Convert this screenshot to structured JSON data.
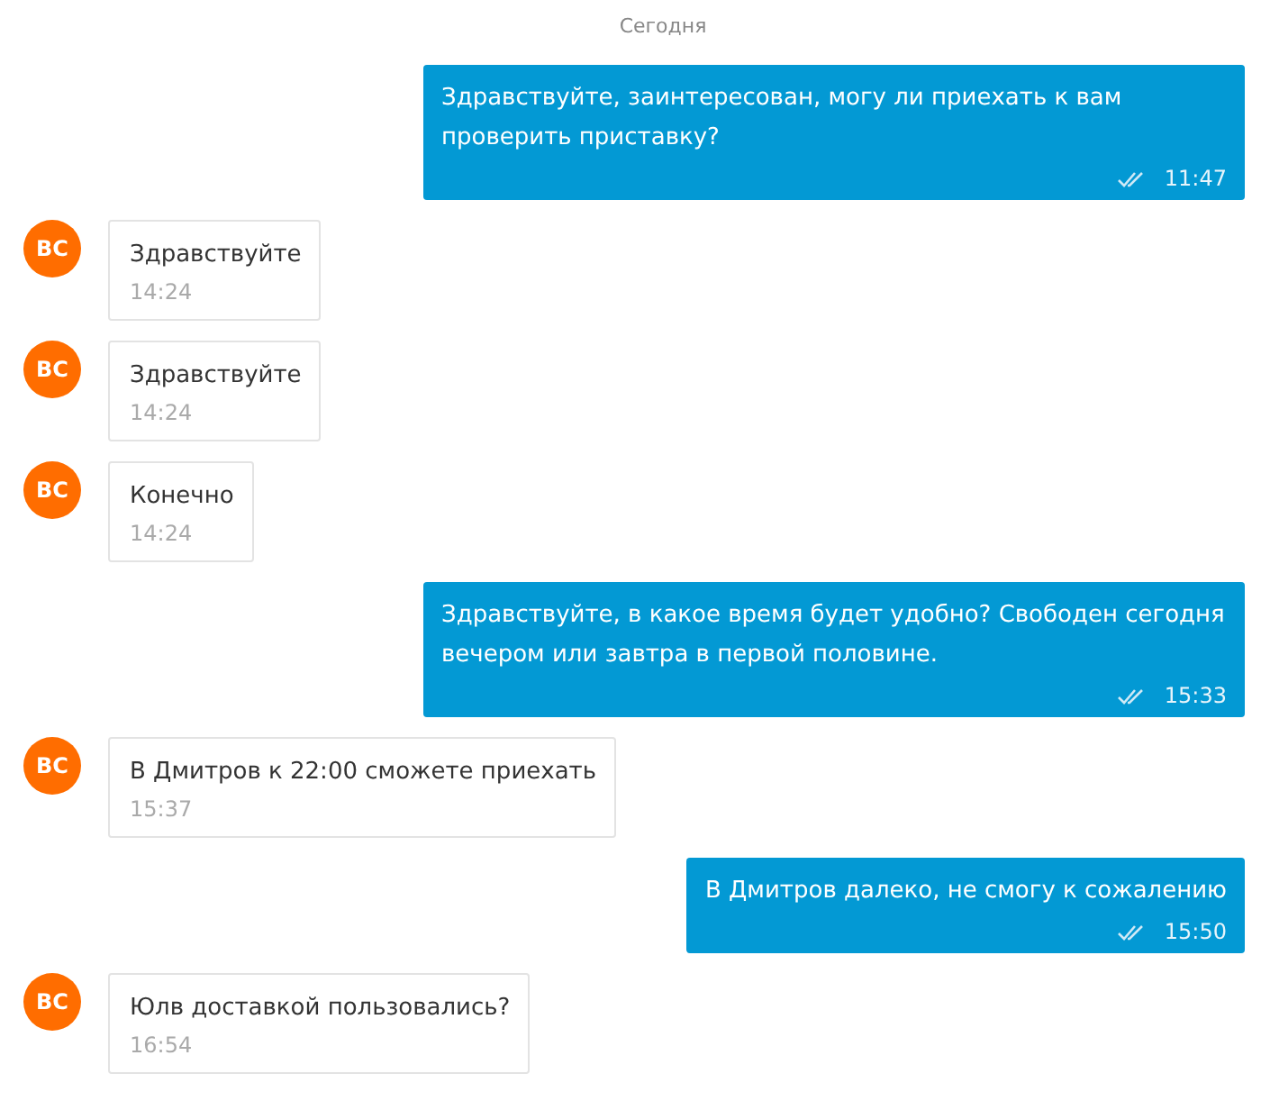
{
  "date_divider": "Сегодня",
  "messages": [
    {
      "kind": "out",
      "text": "Здравствуйте, заинтересован, могу ли приехать к вам проверить приставку?",
      "time": "11:47"
    },
    {
      "kind": "in",
      "avatar": "ВС",
      "text": "Здравствуйте",
      "time": "14:24"
    },
    {
      "kind": "in",
      "avatar": "ВС",
      "text": "Здравствуйте",
      "time": "14:24"
    },
    {
      "kind": "in",
      "avatar": "ВС",
      "text": "Конечно",
      "time": "14:24"
    },
    {
      "kind": "out",
      "text": "Здравствуйте, в какое время будет удобно? Свободен сегодня вечером или завтра в первой половине.",
      "time": "15:33"
    },
    {
      "kind": "in",
      "avatar": "ВС",
      "text": "В Дмитров к 22:00 сможете приехать",
      "time": "15:37"
    },
    {
      "kind": "out",
      "text": "В Дмитров далеко, не смогу к сожалению",
      "time": "15:50"
    },
    {
      "kind": "in",
      "avatar": "ВС",
      "text": "Юлв доставкой пользовались?",
      "time": "16:54"
    }
  ]
}
